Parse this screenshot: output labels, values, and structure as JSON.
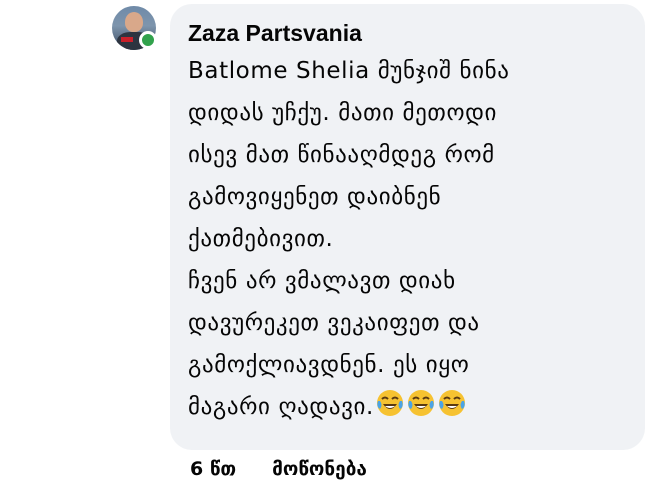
{
  "comment": {
    "author": "Zaza Partsvania",
    "lines": [
      "Batlome Shelia მუნჯიშ ნინა",
      "დიდას უჩქუ. მათი მეთოდი",
      "ისევ მათ წინააღმდეგ რომ",
      "გამოვიყენეთ დაიბნენ",
      "ქათმებივით.",
      "ჩვენ არ ვმალავთ დიახ",
      "დავურეკეთ ვეკაიფეთ და",
      "გამოქლიავდნენ. ეს იყო",
      "მაგარი ღადავი."
    ],
    "emoji_icons": [
      "face-with-tears-of-joy-icon",
      "face-with-tears-of-joy-icon",
      "face-with-tears-of-joy-icon"
    ],
    "online": true
  },
  "actions": {
    "timestamp": "6 წთ",
    "like_label": "მოწონება"
  },
  "colors": {
    "bubble": "#f0f2f5",
    "online": "#31a24c",
    "text": "#050505",
    "emoji_face": "#f6c231"
  }
}
